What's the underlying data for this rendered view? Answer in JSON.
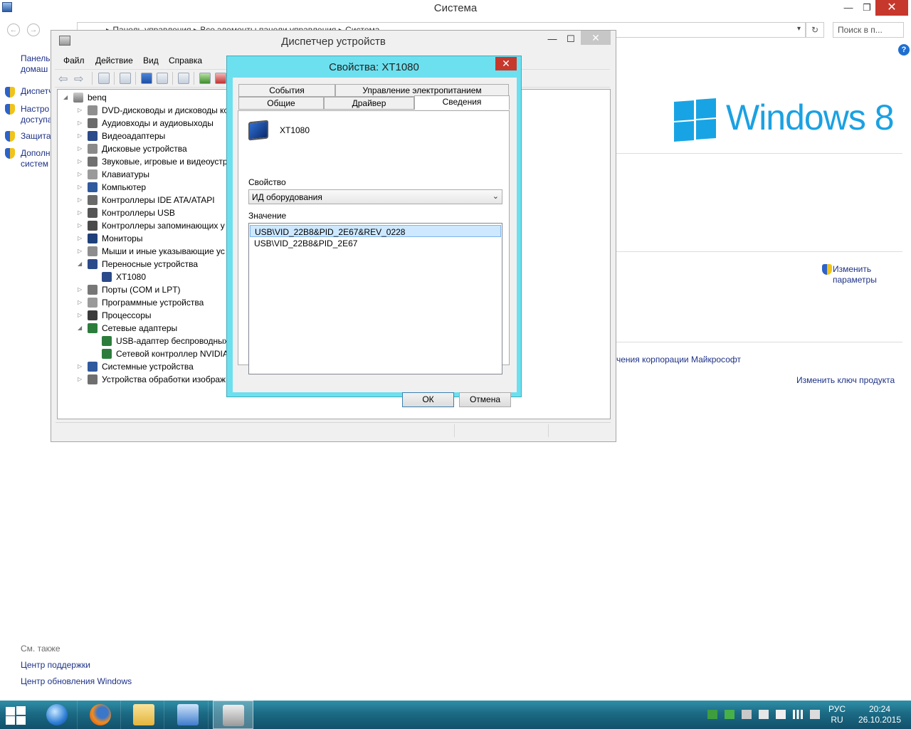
{
  "system_window": {
    "title": "Система",
    "address_path": "▸  Панель управления  ▸  Все элементы панели управления  ▸  Система",
    "search_placeholder": "Поиск в п...",
    "left_links": [
      "Диспетчер устройств",
      "Настройка удаленного доступа",
      "Защита системы",
      "Дополнительные параметры системы"
    ],
    "left_links_visible": [
      "Диспетч",
      "Настро\nдоступа",
      "Защита",
      "Дополн\nсистем"
    ],
    "windows_logo_text": "Windows",
    "windows_logo_version": "8",
    "change_settings": "Изменить\nпараметры",
    "license_text": "чения корпорации Майкрософт",
    "change_key": "Изменить ключ продукта",
    "see_also": {
      "heading": "См. также",
      "links": [
        "Центр поддержки",
        "Центр обновления Windows"
      ]
    }
  },
  "device_manager": {
    "title": "Диспетчер устройств",
    "menu": [
      "Файл",
      "Действие",
      "Вид",
      "Справка"
    ],
    "root": "benq",
    "tree": [
      {
        "label": "DVD-дисководы и дисководы компакт-дисков",
        "visible": "DVD-дисководы и дисководы ко",
        "expanded": false,
        "color": "#8f8f8f"
      },
      {
        "label": "Аудиовходы и аудиовыходы",
        "visible": "Аудиовходы и аудиовыходы",
        "expanded": false,
        "color": "#6b6b6b"
      },
      {
        "label": "Видеоадаптеры",
        "visible": "Видеоадаптеры",
        "expanded": false,
        "color": "#2b4a8a"
      },
      {
        "label": "Дисковые устройства",
        "visible": "Дисковые устройства",
        "expanded": false,
        "color": "#8a8a8a"
      },
      {
        "label": "Звуковые, игровые и видеоустройства",
        "visible": "Звуковые, игровые и видеоустр",
        "expanded": false,
        "color": "#707070"
      },
      {
        "label": "Клавиатуры",
        "visible": "Клавиатуры",
        "expanded": false,
        "color": "#9a9a9a"
      },
      {
        "label": "Компьютер",
        "visible": "Компьютер",
        "expanded": false,
        "color": "#2f5a9e"
      },
      {
        "label": "Контроллеры IDE ATA/ATAPI",
        "visible": "Контроллеры IDE ATA/ATAPI",
        "expanded": false,
        "color": "#6a6a6a"
      },
      {
        "label": "Контроллеры USB",
        "visible": "Контроллеры USB",
        "expanded": false,
        "color": "#555555"
      },
      {
        "label": "Контроллеры запоминающих устройств",
        "visible": "Контроллеры запоминающих у",
        "expanded": false,
        "color": "#4a4a4a"
      },
      {
        "label": "Мониторы",
        "visible": "Мониторы",
        "expanded": false,
        "color": "#1f3f7a"
      },
      {
        "label": "Мыши и иные указывающие устройства",
        "visible": "Мыши и иные указывающие ус",
        "expanded": false,
        "color": "#8d8d8d"
      },
      {
        "label": "Переносные устройства",
        "visible": "Переносные устройства",
        "expanded": true,
        "color": "#2b4a8a"
      },
      {
        "label": "XT1080",
        "visible": "XT1080",
        "child": true,
        "color": "#2b4a8a"
      },
      {
        "label": "Порты (COM и LPT)",
        "visible": "Порты (COM и LPT)",
        "expanded": false,
        "color": "#777777"
      },
      {
        "label": "Программные устройства",
        "visible": "Программные устройства",
        "expanded": false,
        "color": "#9a9a9a"
      },
      {
        "label": "Процессоры",
        "visible": "Процессоры",
        "expanded": false,
        "color": "#3a3a3a"
      },
      {
        "label": "Сетевые адаптеры",
        "visible": "Сетевые адаптеры",
        "expanded": true,
        "color": "#2c7d3c"
      },
      {
        "label": "USB-адаптер беспроводных сетей",
        "visible": "USB-адаптер беспроводных с",
        "child": true,
        "color": "#2c7d3c"
      },
      {
        "label": "Сетевой контроллер NVIDIA",
        "visible": "Сетевой контроллер NVIDIA",
        "child": true,
        "color": "#2c7d3c"
      },
      {
        "label": "Системные устройства",
        "visible": "Системные устройства",
        "expanded": false,
        "color": "#2f5a9e"
      },
      {
        "label": "Устройства обработки изображений",
        "visible": "Устройства обработки изображ",
        "expanded": false,
        "color": "#6f6f6f"
      }
    ]
  },
  "properties": {
    "title": "Свойства: XT1080",
    "tabs_row1": [
      "События",
      "Управление электропитанием"
    ],
    "tabs_row2": [
      "Общие",
      "Драйвер",
      "Сведения"
    ],
    "active_tab": "Сведения",
    "device_name": "XT1080",
    "property_label": "Свойство",
    "property_value": "ИД оборудования",
    "value_label": "Значение",
    "values": [
      "USB\\VID_22B8&PID_2E67&REV_0228",
      "USB\\VID_22B8&PID_2E67"
    ],
    "ok": "ОК",
    "cancel": "Отмена"
  },
  "taskbar": {
    "apps": [
      "internet-explorer",
      "firefox",
      "file-explorer",
      "control-panel",
      "device-manager"
    ],
    "lang_top": "РУС",
    "lang_bottom": "RU",
    "time": "20:24",
    "date": "26.10.2015"
  },
  "colors": {
    "dialog_frame": "#6de0ef",
    "link": "#1e3287",
    "windows_blue": "#1ba1e2",
    "close_red": "#c7382c"
  }
}
